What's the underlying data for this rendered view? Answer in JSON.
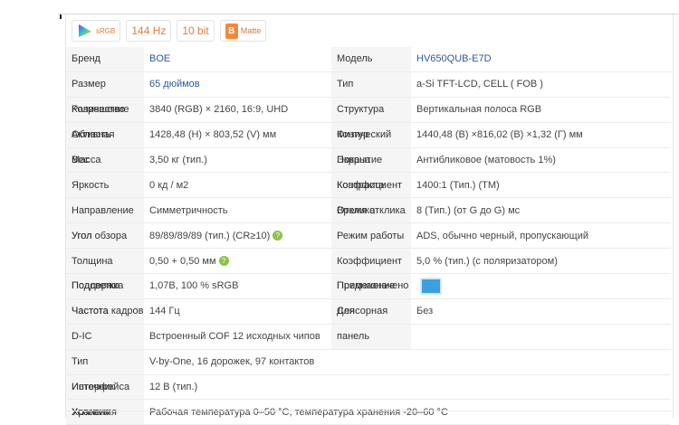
{
  "badges": [
    {
      "label": "sRGB",
      "icon": "color-gamut-icon"
    },
    {
      "label": "144 Hz"
    },
    {
      "label": "10 bit"
    },
    {
      "label": "Matte",
      "icon_letter": "B"
    }
  ],
  "specs": {
    "r1": {
      "l1": "Бренд",
      "v1": "BOE",
      "l2": "Модель",
      "v2": "HV650QUB-E7D"
    },
    "r2": {
      "l1": "Размер",
      "v1": "65 дюймов",
      "l2": "Тип",
      "v2": "a-Si TFT-LCD, CELL ( FOB )"
    },
    "r3": {
      "l1a": "Количество",
      "l1b": "Разрешение",
      "v1": "3840 (RGB) × 2160, 16:9, UHD",
      "l2": "Структура",
      "v2": "Вертикальная полоса RGB"
    },
    "r4": {
      "l1a": "Активная",
      "l1b": "Область",
      "v1": "1428,48 (H) × 803,52 (V) мм",
      "l2a": "Физический",
      "l2b": "Контур",
      "v2": "1440,48 (В) ×816,02 (В) ×1,32 (Г) мм"
    },
    "r5": {
      "l1a": "Масса",
      "l1b": "Вес",
      "v1": "3,50 кг (тип.)",
      "l2a": "Покрытие",
      "l2b": "Экрана",
      "v2": "Антибликовое (матовость 1%)"
    },
    "r6": {
      "l1": "Яркость",
      "v1": "0 кд / м2",
      "l2a": "Коэффициент",
      "l2b": "Контраста",
      "v2": "1400:1 (Тип.) (TM)"
    },
    "r7": {
      "l1": "Направление",
      "v1": "Симметричность",
      "l2a": "Время отклика",
      "l2b": "Отклика",
      "v2": "8 (Тип.) (от G до G) мс"
    },
    "r8": {
      "l1a": "Угол обзора",
      "l1b": "Угол",
      "v1": "89/89/89/89 (тип.) (CR≥10)",
      "l2": "Режим работы",
      "v2": "ADS, обычно черный, пропускающий"
    },
    "r9": {
      "l1": "Толщина",
      "v1": "0,50 + 0,50 мм",
      "l2": "Коэффициент",
      "v2": "5,0 % (тип.) (с поляризатором)"
    },
    "r10": {
      "l1a": "Подсветка",
      "l1b": "Поддержка",
      "v1": "1,07B, 100 % sRGB",
      "l2a": "Предназначено",
      "l2b": "Применение"
    },
    "r11": {
      "l1a": "Частота кадров",
      "l1b": "Частота",
      "v1": "144 Гц",
      "l2a": "Сенсорная",
      "l2b": "Для",
      "v2": "Без"
    },
    "r12": {
      "l1": "D-IC",
      "v1": "Встроенный COF 12 исходных чипов",
      "l2": "панель",
      "v2": ""
    },
    "r13": {
      "l1": "Тип",
      "v1": "V-by-One, 16 дорожек, 97 контактов"
    },
    "r14": {
      "l1a": "Интерфейса",
      "l1b": "Источник",
      "v1": "12 В (тип.)"
    },
    "r15": {
      "l1a": "Условия",
      "l1b": "Хранения",
      "v1": "Рабочая температура 0–50 °C, температура хранения -20–60 °C"
    }
  },
  "colors": {
    "accent_orange": "#e57b3c",
    "link_blue": "#2d5aa0",
    "label_bg": "#f5f5f5"
  }
}
